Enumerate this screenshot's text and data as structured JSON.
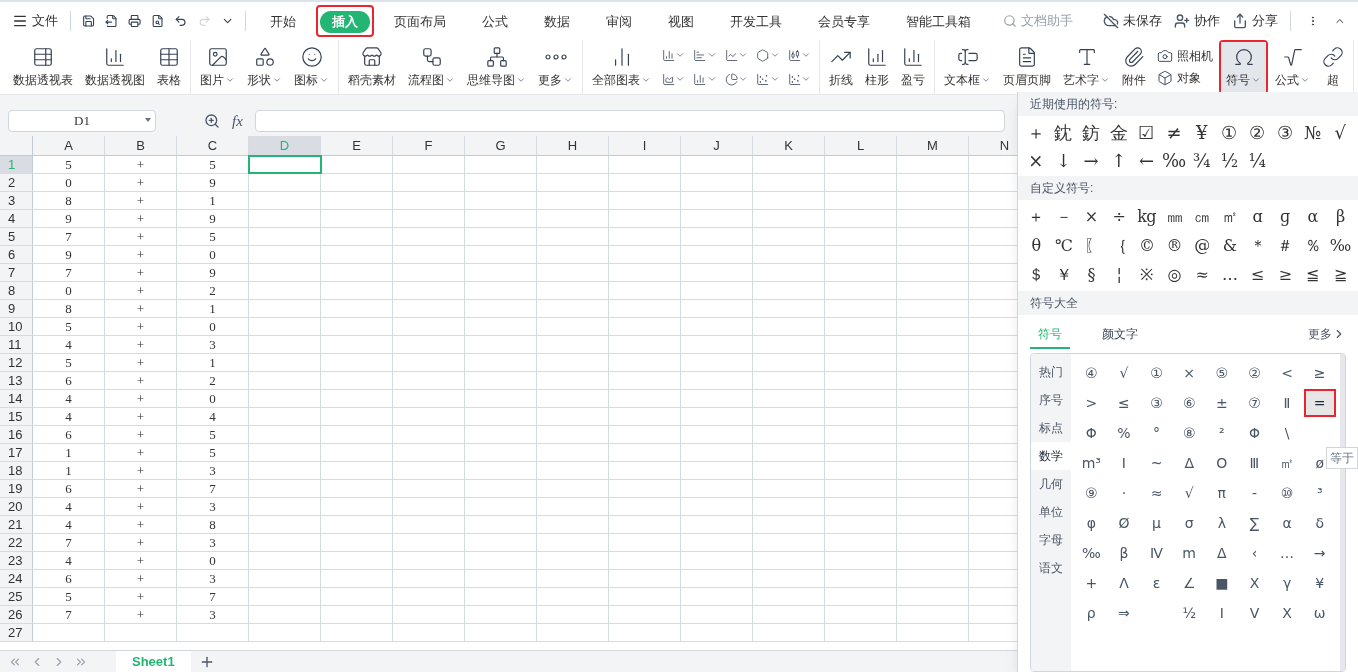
{
  "title_bar": {
    "file_menu": "文件",
    "tabs": [
      {
        "label": "开始",
        "selected": false,
        "annotated": false
      },
      {
        "label": "插入",
        "selected": true,
        "annotated": true
      },
      {
        "label": "页面布局",
        "selected": false,
        "annotated": false
      },
      {
        "label": "公式",
        "selected": false,
        "annotated": false
      },
      {
        "label": "数据",
        "selected": false,
        "annotated": false
      },
      {
        "label": "审阅",
        "selected": false,
        "annotated": false
      },
      {
        "label": "视图",
        "selected": false,
        "annotated": false
      },
      {
        "label": "开发工具",
        "selected": false,
        "annotated": false
      },
      {
        "label": "会员专享",
        "selected": false,
        "annotated": false
      },
      {
        "label": "智能工具箱",
        "selected": false,
        "annotated": false
      }
    ],
    "search": {
      "placeholder": "文档助手"
    },
    "actions": [
      "未保存",
      "协作",
      "分享"
    ]
  },
  "ribbon": {
    "groups": [
      [
        {
          "kind": "large",
          "label": "数据透视表",
          "dropdown": false,
          "active": false,
          "annotated": false
        },
        {
          "kind": "large",
          "label": "数据透视图",
          "dropdown": false,
          "active": false,
          "annotated": false
        },
        {
          "kind": "large",
          "label": "表格",
          "dropdown": false,
          "active": false,
          "annotated": false
        }
      ],
      [
        {
          "kind": "large",
          "label": "图片",
          "dropdown": true,
          "active": false,
          "annotated": false
        },
        {
          "kind": "large",
          "label": "形状",
          "dropdown": true,
          "active": false,
          "annotated": false
        },
        {
          "kind": "large",
          "label": "图标",
          "dropdown": true,
          "active": false,
          "annotated": false
        }
      ],
      [
        {
          "kind": "large",
          "label": "稻壳素材",
          "dropdown": false,
          "active": false,
          "annotated": false
        },
        {
          "kind": "large",
          "label": "流程图",
          "dropdown": true,
          "active": false,
          "annotated": false
        },
        {
          "kind": "large",
          "label": "思维导图",
          "dropdown": true,
          "active": false,
          "annotated": false
        },
        {
          "kind": "large",
          "label": "更多",
          "dropdown": true,
          "active": false,
          "annotated": false
        }
      ],
      [
        {
          "kind": "large",
          "label": "全部图表",
          "dropdown": true,
          "active": false,
          "annotated": false
        },
        {
          "kind": "chart-grid"
        }
      ],
      [
        {
          "kind": "large",
          "label": "折线",
          "dropdown": false,
          "active": false,
          "annotated": false
        },
        {
          "kind": "large",
          "label": "柱形",
          "dropdown": false,
          "active": false,
          "annotated": false
        },
        {
          "kind": "large",
          "label": "盈亏",
          "dropdown": false,
          "active": false,
          "annotated": false
        }
      ],
      [
        {
          "kind": "large",
          "label": "文本框",
          "dropdown": true,
          "active": false,
          "annotated": false
        },
        {
          "kind": "large",
          "label": "页眉页脚",
          "dropdown": false,
          "active": false,
          "annotated": false
        },
        {
          "kind": "large",
          "label": "艺术字",
          "dropdown": true,
          "active": false,
          "annotated": false
        },
        {
          "kind": "large",
          "label": "附件",
          "dropdown": false,
          "active": false,
          "annotated": false
        },
        {
          "kind": "stack",
          "items": [
            "照相机",
            "对象"
          ]
        },
        {
          "kind": "large",
          "label": "符号",
          "dropdown": true,
          "active": true,
          "annotated": true
        },
        {
          "kind": "large",
          "label": "公式",
          "dropdown": true,
          "active": false,
          "annotated": false
        },
        {
          "kind": "large",
          "label": "超",
          "dropdown": false,
          "active": false,
          "annotated": false
        }
      ]
    ]
  },
  "formula_bar": {
    "name_box": "D1",
    "fx_label": "fx"
  },
  "sheet": {
    "columns": [
      {
        "label": "A",
        "selected": false
      },
      {
        "label": "B",
        "selected": false
      },
      {
        "label": "C",
        "selected": false
      },
      {
        "label": "D",
        "selected": true
      },
      {
        "label": "E",
        "selected": false
      },
      {
        "label": "F",
        "selected": false
      },
      {
        "label": "G",
        "selected": false
      },
      {
        "label": "H",
        "selected": false
      },
      {
        "label": "I",
        "selected": false
      },
      {
        "label": "J",
        "selected": false
      },
      {
        "label": "K",
        "selected": false
      },
      {
        "label": "L",
        "selected": false
      },
      {
        "label": "M",
        "selected": false
      },
      {
        "label": "N",
        "selected": false
      }
    ],
    "rows": [
      {
        "number": "1",
        "selected": true,
        "cells": [
          "5",
          "+",
          "5"
        ]
      },
      {
        "number": "2",
        "selected": false,
        "cells": [
          "0",
          "+",
          "9"
        ]
      },
      {
        "number": "3",
        "selected": false,
        "cells": [
          "8",
          "+",
          "1"
        ]
      },
      {
        "number": "4",
        "selected": false,
        "cells": [
          "9",
          "+",
          "9"
        ]
      },
      {
        "number": "5",
        "selected": false,
        "cells": [
          "7",
          "+",
          "5"
        ]
      },
      {
        "number": "6",
        "selected": false,
        "cells": [
          "9",
          "+",
          "0"
        ]
      },
      {
        "number": "7",
        "selected": false,
        "cells": [
          "7",
          "+",
          "9"
        ]
      },
      {
        "number": "8",
        "selected": false,
        "cells": [
          "0",
          "+",
          "2"
        ]
      },
      {
        "number": "9",
        "selected": false,
        "cells": [
          "8",
          "+",
          "1"
        ]
      },
      {
        "number": "10",
        "selected": false,
        "cells": [
          "5",
          "+",
          "0"
        ]
      },
      {
        "number": "11",
        "selected": false,
        "cells": [
          "4",
          "+",
          "3"
        ]
      },
      {
        "number": "12",
        "selected": false,
        "cells": [
          "5",
          "+",
          "1"
        ]
      },
      {
        "number": "13",
        "selected": false,
        "cells": [
          "6",
          "+",
          "2"
        ]
      },
      {
        "number": "14",
        "selected": false,
        "cells": [
          "4",
          "+",
          "0"
        ]
      },
      {
        "number": "15",
        "selected": false,
        "cells": [
          "4",
          "+",
          "4"
        ]
      },
      {
        "number": "16",
        "selected": false,
        "cells": [
          "6",
          "+",
          "5"
        ]
      },
      {
        "number": "17",
        "selected": false,
        "cells": [
          "1",
          "+",
          "5"
        ]
      },
      {
        "number": "18",
        "selected": false,
        "cells": [
          "1",
          "+",
          "3"
        ]
      },
      {
        "number": "19",
        "selected": false,
        "cells": [
          "6",
          "+",
          "7"
        ]
      },
      {
        "number": "20",
        "selected": false,
        "cells": [
          "4",
          "+",
          "3"
        ]
      },
      {
        "number": "21",
        "selected": false,
        "cells": [
          "4",
          "+",
          "8"
        ]
      },
      {
        "number": "22",
        "selected": false,
        "cells": [
          "7",
          "+",
          "3"
        ]
      },
      {
        "number": "23",
        "selected": false,
        "cells": [
          "4",
          "+",
          "0"
        ]
      },
      {
        "number": "24",
        "selected": false,
        "cells": [
          "6",
          "+",
          "3"
        ]
      },
      {
        "number": "25",
        "selected": false,
        "cells": [
          "5",
          "+",
          "7"
        ]
      },
      {
        "number": "26",
        "selected": false,
        "cells": [
          "7",
          "+",
          "3"
        ]
      },
      {
        "number": "27",
        "selected": false
      }
    ],
    "sheet_tabs": [
      {
        "label": "Sheet1",
        "selected": true
      }
    ]
  },
  "symbol_panel": {
    "recent_title": "近期使用的符号:",
    "recent": [
      "＋",
      "鈂",
      "鈁",
      "金",
      "☑",
      "≠",
      "¥",
      "①",
      "②",
      "③",
      "№",
      "√",
      "×",
      "↓",
      "→",
      "↑",
      "←",
      "‰",
      "¾",
      "½",
      "¼"
    ],
    "custom_title": "自定义符号:",
    "custom": [
      "＋",
      "－",
      "×",
      "÷",
      "kg",
      "㎜",
      "㎝",
      "㎡",
      "ɑ",
      "ɡ",
      "α",
      "β",
      "θ",
      "℃",
      "〖",
      "｛",
      "©",
      "®",
      "@",
      "&",
      "＊",
      "＃",
      "％",
      "‰",
      "＄",
      "￥",
      "§",
      "¦",
      "※",
      "◎",
      "≈",
      "…",
      "≤",
      "≥",
      "≦",
      "≧"
    ],
    "library_title": "符号大全",
    "tabs": [
      {
        "label": "符号",
        "selected": true
      },
      {
        "label": "颜文字",
        "selected": false
      }
    ],
    "more": "更多",
    "categories": [
      {
        "label": "热门",
        "selected": false
      },
      {
        "label": "序号",
        "selected": false
      },
      {
        "label": "标点",
        "selected": false
      },
      {
        "label": "数学",
        "selected": true
      },
      {
        "label": "几何",
        "selected": false
      },
      {
        "label": "单位",
        "selected": false
      },
      {
        "label": "字母",
        "selected": false
      },
      {
        "label": "语文",
        "selected": false
      }
    ],
    "grid": [
      [
        {
          "s": "④",
          "annotated": false
        },
        {
          "s": "√",
          "annotated": false
        },
        {
          "s": "①",
          "annotated": false
        },
        {
          "s": "×",
          "annotated": false
        },
        {
          "s": "⑤",
          "annotated": false
        },
        {
          "s": "②",
          "annotated": false
        },
        {
          "s": "<",
          "annotated": false
        },
        {
          "s": "≥",
          "annotated": false
        }
      ],
      [
        {
          "s": ">",
          "annotated": false
        },
        {
          "s": "≤",
          "annotated": false
        },
        {
          "s": "③",
          "annotated": false
        },
        {
          "s": "⑥",
          "annotated": false
        },
        {
          "s": "±",
          "annotated": false
        },
        {
          "s": "⑦",
          "annotated": false
        },
        {
          "s": "Ⅱ",
          "annotated": false
        },
        {
          "s": "=",
          "annotated": true
        }
      ],
      [
        {
          "s": "Φ",
          "annotated": false
        },
        {
          "s": "%",
          "annotated": false
        },
        {
          "s": "°",
          "annotated": false
        },
        {
          "s": "⑧",
          "annotated": false
        },
        {
          "s": "²",
          "annotated": false
        },
        {
          "s": "Φ",
          "annotated": false
        },
        {
          "s": "\\",
          "annotated": false
        },
        {
          "annotated": false
        }
      ],
      [
        {
          "s": "m³",
          "annotated": false
        },
        {
          "s": "Ⅰ",
          "annotated": false
        },
        {
          "s": "~",
          "annotated": false
        },
        {
          "s": "Δ",
          "annotated": false
        },
        {
          "s": "О",
          "annotated": false
        },
        {
          "s": "Ⅲ",
          "annotated": false
        },
        {
          "s": "㎡",
          "annotated": false
        },
        {
          "s": "ø",
          "annotated": false
        }
      ],
      [
        {
          "s": "⑨",
          "annotated": false
        },
        {
          "s": "·",
          "annotated": false
        },
        {
          "s": "≈",
          "annotated": false
        },
        {
          "s": "√",
          "annotated": false
        },
        {
          "s": "π",
          "annotated": false
        },
        {
          "s": "-",
          "annotated": false
        },
        {
          "s": "⑩",
          "annotated": false
        },
        {
          "s": "³",
          "annotated": false
        }
      ],
      [
        {
          "s": "φ",
          "annotated": false
        },
        {
          "s": "Ø",
          "annotated": false
        },
        {
          "s": "μ",
          "annotated": false
        },
        {
          "s": "σ",
          "annotated": false
        },
        {
          "s": "λ",
          "annotated": false
        },
        {
          "s": "∑",
          "annotated": false
        },
        {
          "s": "α",
          "annotated": false
        },
        {
          "s": "δ",
          "annotated": false
        }
      ],
      [
        {
          "s": "‰",
          "annotated": false
        },
        {
          "s": "β",
          "annotated": false
        },
        {
          "s": "Ⅳ",
          "annotated": false
        },
        {
          "s": "m",
          "annotated": false
        },
        {
          "s": "Δ",
          "annotated": false
        },
        {
          "s": "‹",
          "annotated": false
        },
        {
          "s": "…",
          "annotated": false
        },
        {
          "s": "→",
          "annotated": false
        }
      ],
      [
        {
          "s": "+",
          "annotated": false
        },
        {
          "s": "Λ",
          "annotated": false
        },
        {
          "s": "ε",
          "annotated": false
        },
        {
          "s": "∠",
          "annotated": false
        },
        {
          "s": "■",
          "annotated": false
        },
        {
          "s": "Χ",
          "annotated": false
        },
        {
          "s": "γ",
          "annotated": false
        },
        {
          "s": "¥",
          "annotated": false
        }
      ],
      [
        {
          "s": "ρ",
          "annotated": false
        },
        {
          "s": "⇒",
          "annotated": false
        },
        {
          "annotated": false
        },
        {
          "s": "½",
          "annotated": false
        },
        {
          "s": "Ⅰ",
          "annotated": false
        },
        {
          "s": "Ⅴ",
          "annotated": false
        },
        {
          "s": "Χ",
          "annotated": false
        },
        {
          "s": "ω",
          "annotated": false
        }
      ]
    ],
    "tooltip": "等于"
  }
}
